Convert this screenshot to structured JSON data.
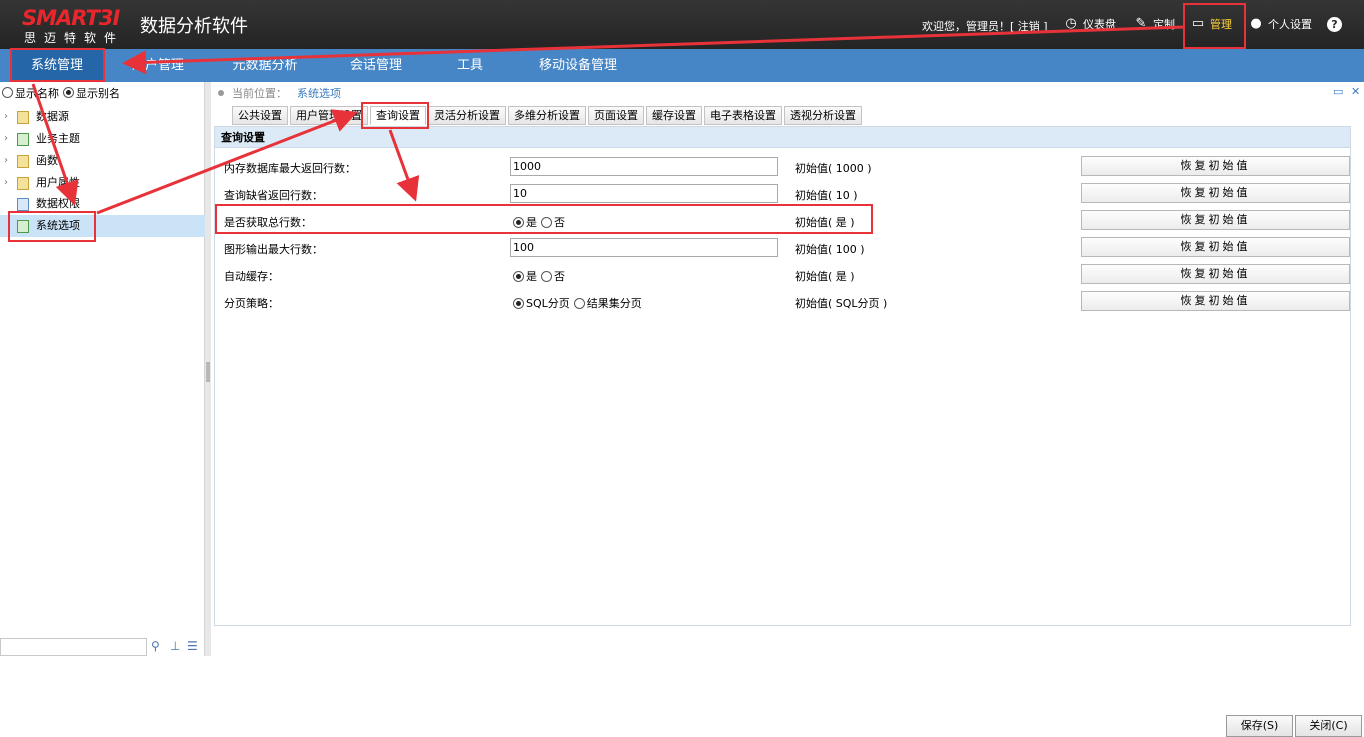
{
  "header": {
    "logo_word": "SMART3I",
    "logo_sub": "思迈特软件",
    "app_title": "数据分析软件",
    "welcome": "欢迎您，管理员！[ 注销 ]",
    "links": [
      {
        "label": "仪表盘",
        "icon": "gauge-icon"
      },
      {
        "label": "定制",
        "icon": "pencil-icon"
      },
      {
        "label": "管理",
        "icon": "monitor-icon"
      },
      {
        "label": "个人设置",
        "icon": "user-icon"
      }
    ],
    "help": "?"
  },
  "nav": {
    "items": [
      "系统管理",
      "用户管理",
      "元数据分析",
      "会话管理",
      "工具",
      "移动设备管理"
    ]
  },
  "sidebar": {
    "display_name": "显示名称",
    "display_alias": "显示别名",
    "tree": [
      {
        "label": "数据源"
      },
      {
        "label": "业务主题"
      },
      {
        "label": "函数"
      },
      {
        "label": "用户属性"
      },
      {
        "label": "数据权限"
      },
      {
        "label": "系统选项"
      }
    ]
  },
  "main": {
    "breadcrumb_prefix": "当前位置：",
    "breadcrumb_current": "系统选项",
    "tabs": [
      "公共设置",
      "用户管理设置",
      "查询设置",
      "灵活分析设置",
      "多维分析设置",
      "页面设置",
      "缓存设置",
      "电子表格设置",
      "透视分析设置"
    ],
    "panel_title": "查询设置",
    "rows": [
      {
        "label": "内存数据库最大返回行数：",
        "value": "1000",
        "init": "初始值( 1000 )"
      },
      {
        "label": "查询缺省返回行数：",
        "value": "10",
        "init": "初始值( 10 )"
      },
      {
        "label": "是否获取总行数：",
        "options": [
          "是",
          "否"
        ],
        "init": "初始值( 是 )"
      },
      {
        "label": "图形输出最大行数：",
        "value": "100",
        "init": "初始值( 100 )"
      },
      {
        "label": "自动缓存：",
        "options": [
          "是",
          "否"
        ],
        "init": "初始值( 是 )"
      },
      {
        "label": "分页策略：",
        "options": [
          "SQL分页",
          "结果集分页"
        ],
        "init": "初始值( SQL分页 )"
      }
    ],
    "reset_label": "恢复初始值",
    "save_label": "保存(S)",
    "close_label": "关闭(C)"
  },
  "colors": {
    "header_bg": "#2c2c2c",
    "nav_bg": "#4686c6",
    "nav_active": "#2466a8",
    "accent_yellow": "#ffd33a",
    "annotation_red": "#e8323a"
  }
}
